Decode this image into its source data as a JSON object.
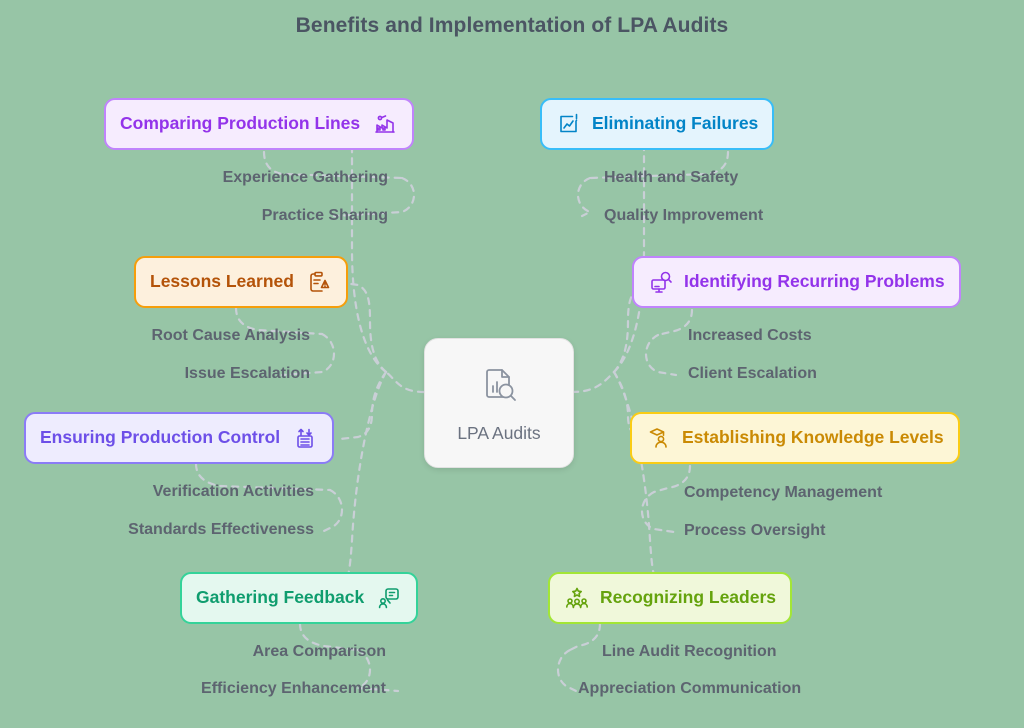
{
  "title": "Benefits and Implementation of LPA Audits",
  "center": {
    "label": "LPA Audits",
    "icon": "document-magnifier-icon"
  },
  "colors": {
    "background": "#97c5a6",
    "title": "#4b5563",
    "sub_text": "#5d6470",
    "purple": "#a855f7",
    "orange": "#f59e0b",
    "violet": "#7c6df2",
    "teal": "#10b981",
    "blue": "#0ea5e9",
    "magenta": "#a855f7",
    "yellow": "#eab308",
    "lime": "#84cc16",
    "center_text": "#6b7280"
  },
  "branches": [
    {
      "id": "comparing-production-lines",
      "label": "Comparing Production Lines",
      "icon": "factory-icon",
      "side": "left",
      "accent": "#a855f7",
      "fill": "#f6ecfe",
      "children": [
        "Experience Gathering",
        "Practice Sharing"
      ]
    },
    {
      "id": "lessons-learned",
      "label": "Lessons Learned",
      "icon": "clipboard-alert-icon",
      "side": "left",
      "accent": "#f59e0b",
      "fill": "#fdf0dd",
      "children": [
        "Root Cause Analysis",
        "Issue Escalation"
      ]
    },
    {
      "id": "ensuring-production-control",
      "label": "Ensuring Production Control",
      "icon": "control-arrows-icon",
      "side": "left",
      "accent": "#7c6df2",
      "fill": "#eeecfe",
      "children": [
        "Verification Activities",
        "Standards Effectiveness"
      ]
    },
    {
      "id": "gathering-feedback",
      "label": "Gathering Feedback",
      "icon": "feedback-chat-icon",
      "side": "left",
      "accent": "#10b981",
      "fill": "#e4f8ef",
      "children": [
        "Area Comparison",
        "Efficiency Enhancement"
      ]
    },
    {
      "id": "eliminating-failures",
      "label": "Eliminating Failures",
      "icon": "chart-alert-icon",
      "side": "right",
      "accent": "#0ea5e9",
      "fill": "#e4f4fd",
      "children": [
        "Health and Safety",
        "Quality Improvement"
      ]
    },
    {
      "id": "identifying-recurring-problems",
      "label": "Identifying Recurring Problems",
      "icon": "monitor-search-icon",
      "side": "right",
      "accent": "#a855f7",
      "fill": "#f6ecfe",
      "children": [
        "Increased Costs",
        "Client Escalation"
      ]
    },
    {
      "id": "establishing-knowledge-levels",
      "label": "Establishing Knowledge Levels",
      "icon": "graduate-person-icon",
      "side": "right",
      "accent": "#eab308",
      "fill": "#fdf6d6",
      "children": [
        "Competency Management",
        "Process Oversight"
      ]
    },
    {
      "id": "recognizing-leaders",
      "label": "Recognizing Leaders",
      "icon": "team-star-icon",
      "side": "right",
      "accent": "#84cc16",
      "fill": "#f0f8da",
      "children": [
        "Line Audit Recognition",
        "Appreciation Communication"
      ]
    }
  ]
}
